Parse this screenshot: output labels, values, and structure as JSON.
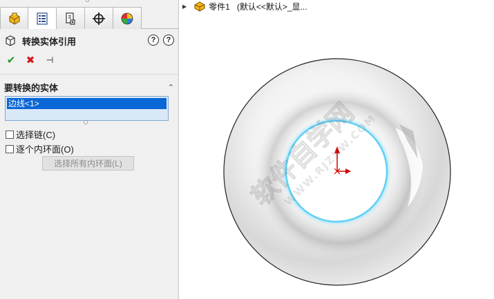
{
  "tabs": [
    {
      "name": "feature-manager",
      "icon": "feature-tree-icon"
    },
    {
      "name": "property-manager",
      "icon": "property-manager-icon",
      "active": true
    },
    {
      "name": "configuration-manager",
      "icon": "configuration-icon"
    },
    {
      "name": "dimxpert-manager",
      "icon": "target-crosshair-icon"
    },
    {
      "name": "display-manager",
      "icon": "display-pie-icon"
    }
  ],
  "property_manager": {
    "title": "转换实体引用",
    "help_label": "?",
    "ok_symbol": "✔",
    "cancel_symbol": "✖",
    "pin_symbol": "⊣",
    "group_title": "要转换的实体",
    "collapse_symbol": "⌃",
    "selected_entity": "边线<1>",
    "select_chain_label": "选择链(C)",
    "inner_loops_label": "逐个内环面(O)",
    "select_all_loops_label": "选择所有内环面(L)"
  },
  "graphics": {
    "tree_arrow": "▶",
    "part_name": "零件1",
    "config_text": "(默认<<默认>_显...",
    "watermark_text": "软件自学网",
    "watermark_url": "WWW.RJZXW.COM"
  },
  "colors": {
    "selection_highlight": "#0a67d6",
    "edge_highlight": "#5fd0f5",
    "origin_red": "#d40000"
  }
}
